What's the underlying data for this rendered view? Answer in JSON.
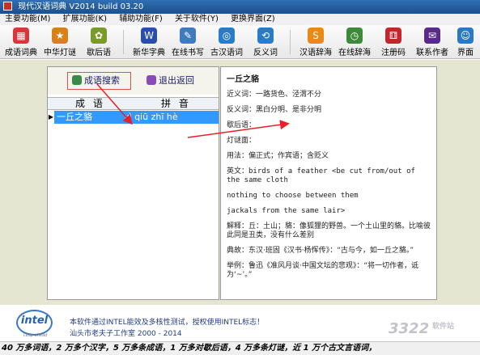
{
  "window": {
    "title": "现代汉语词典 V2014 build 03.20"
  },
  "menu": [
    "主要功能(M)",
    "扩展功能(K)",
    "辅助功能(F)",
    "关于软件(Y)",
    "更换界面(Z)"
  ],
  "toolbar": [
    {
      "label": "成语词典",
      "icon": "grid-icon",
      "color": "#d9363a",
      "glyph": "▦"
    },
    {
      "label": "中华灯谜",
      "icon": "star-icon",
      "color": "#d8801a",
      "glyph": "★"
    },
    {
      "label": "歇后语",
      "icon": "bird-icon",
      "color": "#7a9a2a",
      "glyph": "✿"
    },
    {
      "label": "新华字典",
      "icon": "book-icon",
      "color": "#2a4fa8",
      "glyph": "W"
    },
    {
      "label": "在线书写",
      "icon": "pen-icon",
      "color": "#3f7bbd",
      "glyph": "✎"
    },
    {
      "label": "古汉语词",
      "icon": "gear-icon",
      "color": "#2a7bc8",
      "glyph": "◎"
    },
    {
      "label": "反义词",
      "icon": "refresh-icon",
      "color": "#2a7bc8",
      "glyph": "⟲"
    },
    {
      "label": "汉语辞海",
      "icon": "coin-icon",
      "color": "#e88a1a",
      "glyph": "S"
    },
    {
      "label": "在线辞海",
      "icon": "clock-icon",
      "color": "#3d8a3a",
      "glyph": "◷"
    },
    {
      "label": "注册码",
      "icon": "dice-icon",
      "color": "#c0282c",
      "glyph": "⚅"
    },
    {
      "label": "联系作者",
      "icon": "mail-icon",
      "color": "#5a2a8a",
      "glyph": "✉"
    },
    {
      "label": "界面",
      "icon": "finder-icon",
      "color": "#2a79c8",
      "glyph": "☺"
    }
  ],
  "search": {
    "search_label": "成语搜索",
    "exit_label": "退出返回"
  },
  "grid": {
    "columns": [
      "成 语",
      "拼 音"
    ],
    "rows": [
      {
        "idiom": "一丘之貉",
        "pinyin": "yì qiū zhī hè",
        "marker": "▶"
      }
    ]
  },
  "detail": {
    "title": "一丘之貉",
    "synonym": "近义词：一路货色、泾渭不分",
    "antonym": "反义词：黑白分明、是非分明",
    "xiehouyu": "歇后语：",
    "riddle": "灯谜面：",
    "usage": "用法：偏正式；作宾语；含贬义",
    "english1": "英文：birds of a feather <be cut from/out of the same cloth",
    "english2": " nothing to choose between them",
    "english3": " jackals from the same lair>",
    "explain": "解释：丘：土山；貉：像狐狸的野兽。一个土山里的貉。比喻彼此同是丑类，没有什么差别",
    "source": "典故：东汉·班固《汉书·杨恽传》：“古与今，如一丘之貉。”",
    "example": "举例：鲁迅《准风月谈·中国文坛的悲观》：“将一切作者，诋为‘~’。”"
  },
  "footer": {
    "logo_text": "intel",
    "logo_sub": "Leap ahead",
    "line1": "本软件通过INTEL能效及多核性测试，授权使用INTEL标志！",
    "line2": "汕头市老夫子工作室 2000 - 2014"
  },
  "status": {
    "text": "40 万多词语，2 万多个汉字，5 万多条成语，1 万多对歇后语，4 万多条灯谜，近 1 万个古文言语词，"
  },
  "watermark": {
    "text1": "3322",
    "text2": "软件站"
  }
}
